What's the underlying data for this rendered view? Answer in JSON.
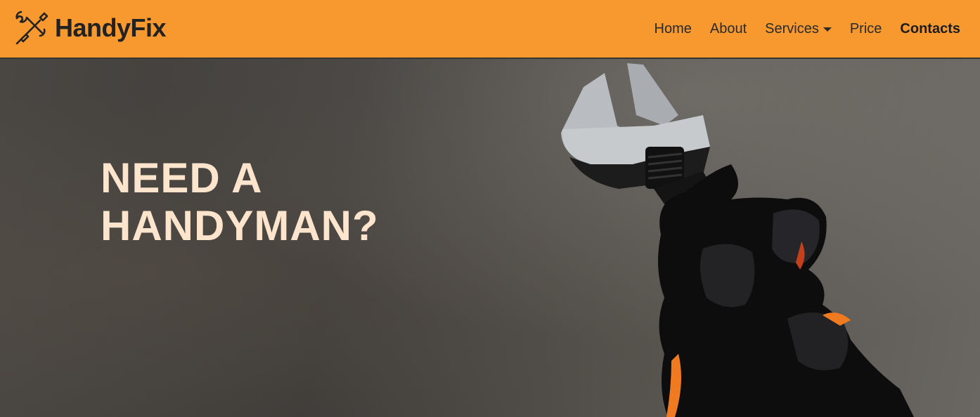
{
  "brand": {
    "name": "HandyFix",
    "logo_icon": "wrench-screwdriver-icon"
  },
  "nav": {
    "items": [
      {
        "label": "Home"
      },
      {
        "label": "About"
      },
      {
        "label": "Services",
        "has_dropdown": true,
        "dropdown_icon": "caret-down-icon"
      },
      {
        "label": "Price"
      },
      {
        "label": "Contacts",
        "active": true
      }
    ]
  },
  "hero": {
    "headline_line1": "NEED A",
    "headline_line2": "HANDYMAN?",
    "image": "gloved-hand-holding-adjustable-wrench"
  },
  "colors": {
    "navbar_bg": "#f7992f",
    "headline": "#fde4cc",
    "nav_text": "#2a2a2a"
  }
}
